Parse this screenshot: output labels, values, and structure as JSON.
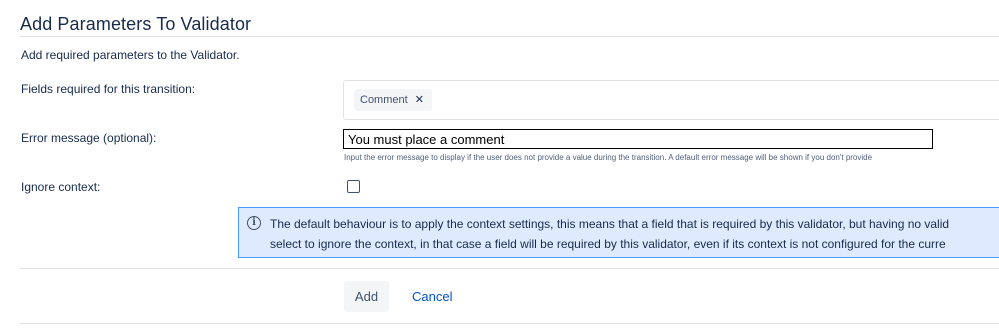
{
  "page": {
    "title": "Add Parameters To Validator",
    "description": "Add required parameters to the Validator."
  },
  "form": {
    "fields_label": "Fields required for this transition:",
    "fields_selected": [
      {
        "label": "Comment",
        "remove_icon": "close-icon"
      }
    ],
    "error_label": "Error message (optional):",
    "error_value": "You must place a comment",
    "error_help": "Input the error message to display if the user does not provide a value during the transition. A default error message will be shown if you don't provide",
    "ignore_label": "Ignore context:",
    "ignore_checked": false
  },
  "info": {
    "icon": "info-icon",
    "line1": "The default behaviour is to apply the context settings, this means that a field that is required by this validator, but having no valid",
    "line2": "select to ignore the context, in that case a field will be required by this validator, even if its context is not configured for the curre"
  },
  "actions": {
    "add_label": "Add",
    "cancel_label": "Cancel"
  },
  "colors": {
    "info_bg": "#deebff",
    "info_border": "#4c9aff",
    "link": "#0052cc",
    "text": "#172b4d"
  }
}
